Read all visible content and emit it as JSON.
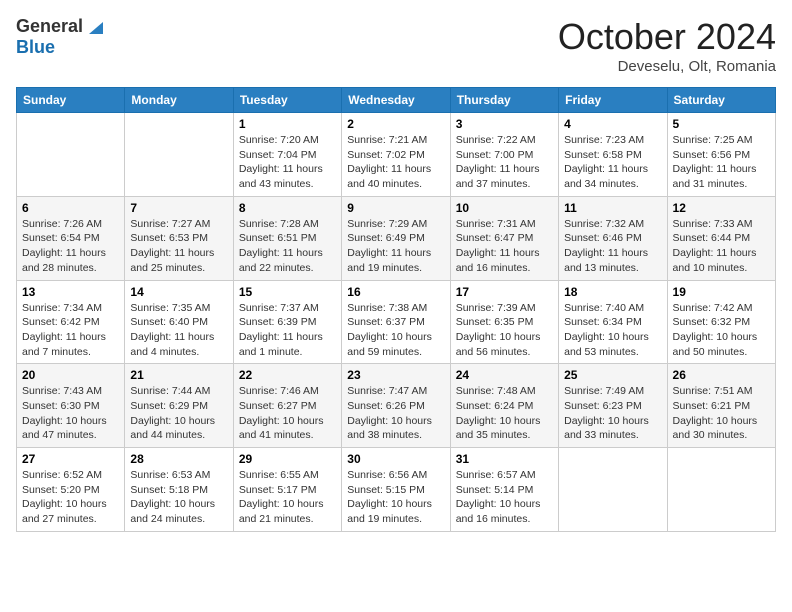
{
  "header": {
    "logo_line1": "General",
    "logo_line2": "Blue",
    "month": "October 2024",
    "location": "Deveselu, Olt, Romania"
  },
  "days_of_week": [
    "Sunday",
    "Monday",
    "Tuesday",
    "Wednesday",
    "Thursday",
    "Friday",
    "Saturday"
  ],
  "weeks": [
    [
      {
        "day": "",
        "info": ""
      },
      {
        "day": "",
        "info": ""
      },
      {
        "day": "1",
        "info": "Sunrise: 7:20 AM\nSunset: 7:04 PM\nDaylight: 11 hours and 43 minutes."
      },
      {
        "day": "2",
        "info": "Sunrise: 7:21 AM\nSunset: 7:02 PM\nDaylight: 11 hours and 40 minutes."
      },
      {
        "day": "3",
        "info": "Sunrise: 7:22 AM\nSunset: 7:00 PM\nDaylight: 11 hours and 37 minutes."
      },
      {
        "day": "4",
        "info": "Sunrise: 7:23 AM\nSunset: 6:58 PM\nDaylight: 11 hours and 34 minutes."
      },
      {
        "day": "5",
        "info": "Sunrise: 7:25 AM\nSunset: 6:56 PM\nDaylight: 11 hours and 31 minutes."
      }
    ],
    [
      {
        "day": "6",
        "info": "Sunrise: 7:26 AM\nSunset: 6:54 PM\nDaylight: 11 hours and 28 minutes."
      },
      {
        "day": "7",
        "info": "Sunrise: 7:27 AM\nSunset: 6:53 PM\nDaylight: 11 hours and 25 minutes."
      },
      {
        "day": "8",
        "info": "Sunrise: 7:28 AM\nSunset: 6:51 PM\nDaylight: 11 hours and 22 minutes."
      },
      {
        "day": "9",
        "info": "Sunrise: 7:29 AM\nSunset: 6:49 PM\nDaylight: 11 hours and 19 minutes."
      },
      {
        "day": "10",
        "info": "Sunrise: 7:31 AM\nSunset: 6:47 PM\nDaylight: 11 hours and 16 minutes."
      },
      {
        "day": "11",
        "info": "Sunrise: 7:32 AM\nSunset: 6:46 PM\nDaylight: 11 hours and 13 minutes."
      },
      {
        "day": "12",
        "info": "Sunrise: 7:33 AM\nSunset: 6:44 PM\nDaylight: 11 hours and 10 minutes."
      }
    ],
    [
      {
        "day": "13",
        "info": "Sunrise: 7:34 AM\nSunset: 6:42 PM\nDaylight: 11 hours and 7 minutes."
      },
      {
        "day": "14",
        "info": "Sunrise: 7:35 AM\nSunset: 6:40 PM\nDaylight: 11 hours and 4 minutes."
      },
      {
        "day": "15",
        "info": "Sunrise: 7:37 AM\nSunset: 6:39 PM\nDaylight: 11 hours and 1 minute."
      },
      {
        "day": "16",
        "info": "Sunrise: 7:38 AM\nSunset: 6:37 PM\nDaylight: 10 hours and 59 minutes."
      },
      {
        "day": "17",
        "info": "Sunrise: 7:39 AM\nSunset: 6:35 PM\nDaylight: 10 hours and 56 minutes."
      },
      {
        "day": "18",
        "info": "Sunrise: 7:40 AM\nSunset: 6:34 PM\nDaylight: 10 hours and 53 minutes."
      },
      {
        "day": "19",
        "info": "Sunrise: 7:42 AM\nSunset: 6:32 PM\nDaylight: 10 hours and 50 minutes."
      }
    ],
    [
      {
        "day": "20",
        "info": "Sunrise: 7:43 AM\nSunset: 6:30 PM\nDaylight: 10 hours and 47 minutes."
      },
      {
        "day": "21",
        "info": "Sunrise: 7:44 AM\nSunset: 6:29 PM\nDaylight: 10 hours and 44 minutes."
      },
      {
        "day": "22",
        "info": "Sunrise: 7:46 AM\nSunset: 6:27 PM\nDaylight: 10 hours and 41 minutes."
      },
      {
        "day": "23",
        "info": "Sunrise: 7:47 AM\nSunset: 6:26 PM\nDaylight: 10 hours and 38 minutes."
      },
      {
        "day": "24",
        "info": "Sunrise: 7:48 AM\nSunset: 6:24 PM\nDaylight: 10 hours and 35 minutes."
      },
      {
        "day": "25",
        "info": "Sunrise: 7:49 AM\nSunset: 6:23 PM\nDaylight: 10 hours and 33 minutes."
      },
      {
        "day": "26",
        "info": "Sunrise: 7:51 AM\nSunset: 6:21 PM\nDaylight: 10 hours and 30 minutes."
      }
    ],
    [
      {
        "day": "27",
        "info": "Sunrise: 6:52 AM\nSunset: 5:20 PM\nDaylight: 10 hours and 27 minutes."
      },
      {
        "day": "28",
        "info": "Sunrise: 6:53 AM\nSunset: 5:18 PM\nDaylight: 10 hours and 24 minutes."
      },
      {
        "day": "29",
        "info": "Sunrise: 6:55 AM\nSunset: 5:17 PM\nDaylight: 10 hours and 21 minutes."
      },
      {
        "day": "30",
        "info": "Sunrise: 6:56 AM\nSunset: 5:15 PM\nDaylight: 10 hours and 19 minutes."
      },
      {
        "day": "31",
        "info": "Sunrise: 6:57 AM\nSunset: 5:14 PM\nDaylight: 10 hours and 16 minutes."
      },
      {
        "day": "",
        "info": ""
      },
      {
        "day": "",
        "info": ""
      }
    ]
  ]
}
